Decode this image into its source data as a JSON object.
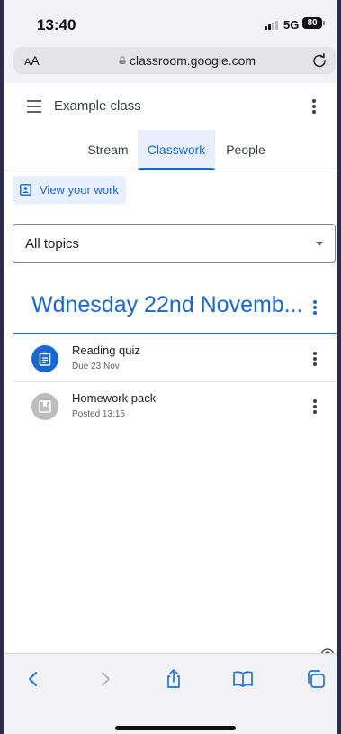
{
  "status": {
    "time": "13:40",
    "network": "5G",
    "battery": "80"
  },
  "browser": {
    "aa_small": "A",
    "aa_large": "A",
    "url": "classroom.google.com"
  },
  "header": {
    "class_name": "Example class"
  },
  "tabs": [
    {
      "label": "Stream",
      "active": false
    },
    {
      "label": "Classwork",
      "active": true
    },
    {
      "label": "People",
      "active": false
    }
  ],
  "view_work": {
    "label": "View your work"
  },
  "topics": {
    "selected": "All topics"
  },
  "section": {
    "title": "Wdnesday 22nd Novemb..."
  },
  "items": [
    {
      "title": "Reading quiz",
      "subtitle": "Due 23 Nov",
      "icon": "assignment-icon",
      "color": "#1967d2"
    },
    {
      "title": "Homework pack",
      "subtitle": "Posted 13:15",
      "icon": "material-icon",
      "color": "#bdbdbd"
    }
  ],
  "colors": {
    "accent": "#1967d2",
    "accent_bg": "#e8f0fe",
    "ios_blue": "#1a73e8"
  }
}
